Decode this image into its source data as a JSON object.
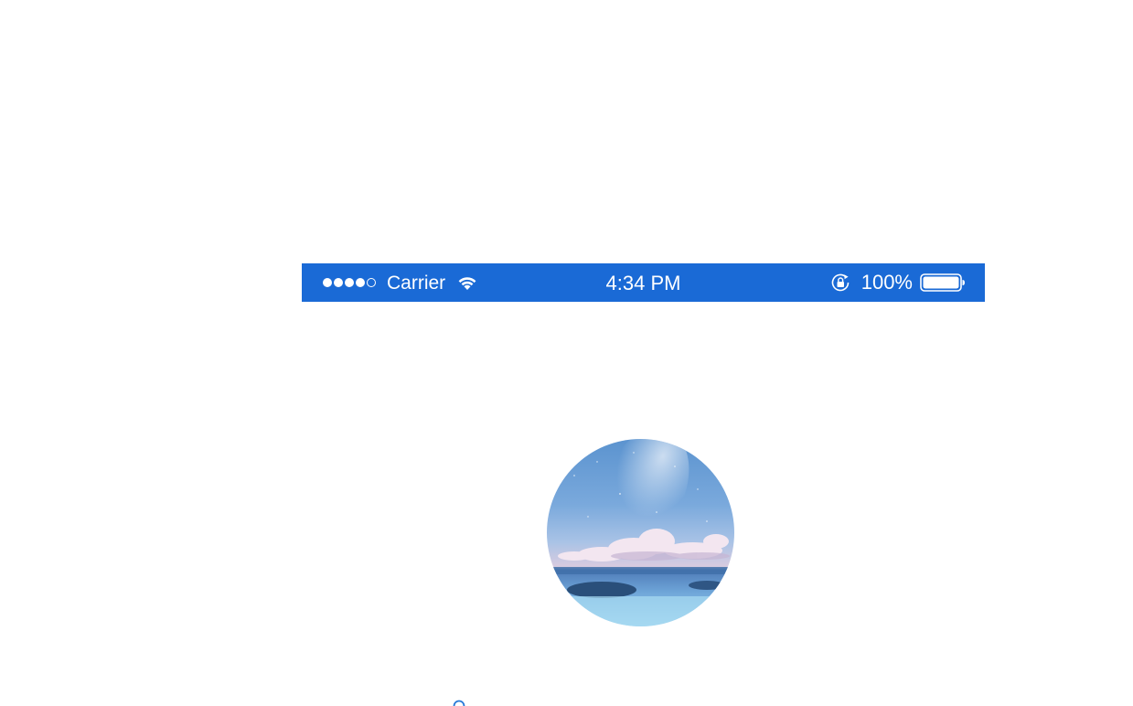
{
  "colors": {
    "status_bar_bg": "#1a6ad6",
    "status_text": "#ffffff",
    "page_bg": "#ffffff",
    "spinner": "#2a7ad8"
  },
  "status_bar": {
    "signal_strength": "4/5",
    "carrier": "Carrier",
    "wifi_icon": "wifi-icon",
    "time": "4:34 PM",
    "orientation_lock_icon": "orientation-lock-icon",
    "battery_percent": "100%",
    "battery_level": 1.0
  },
  "avatar": {
    "icon": "avatar",
    "description_colors": [
      "#5b9bd5",
      "#c9d8ef",
      "#3d6f9e"
    ]
  },
  "loading": {
    "icon": "spinner-icon"
  }
}
